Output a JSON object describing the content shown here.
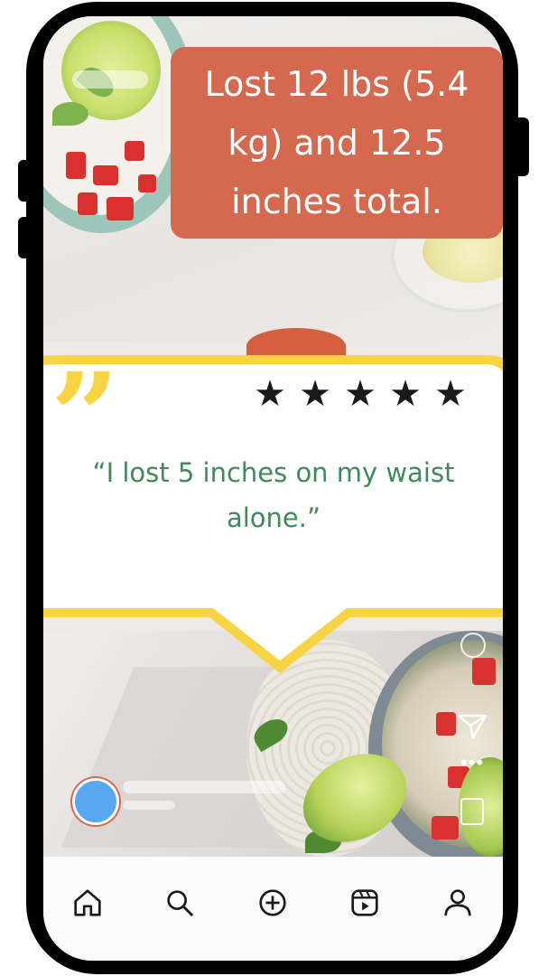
{
  "post": {
    "headline": "Lost 12 lbs (5.4\nkg) and 12.5\ninches total.",
    "rating_stars": 5,
    "testimonial": "“I lost 5 inches on my waist\nalone.”"
  },
  "icons": {
    "stars": [
      "star-icon",
      "star-icon",
      "star-icon",
      "star-icon",
      "star-icon"
    ],
    "side_actions": [
      "heart-icon",
      "send-icon",
      "more-icon",
      "bookmark-icon"
    ],
    "nav": [
      "home-icon",
      "search-icon",
      "create-icon",
      "reels-icon",
      "profile-icon"
    ]
  },
  "colors": {
    "headline_bg": "#d5694f",
    "quote_yellow": "#f8d445",
    "testimonial_green": "#3f8a5b",
    "avatar_blue": "#57a8ee"
  }
}
